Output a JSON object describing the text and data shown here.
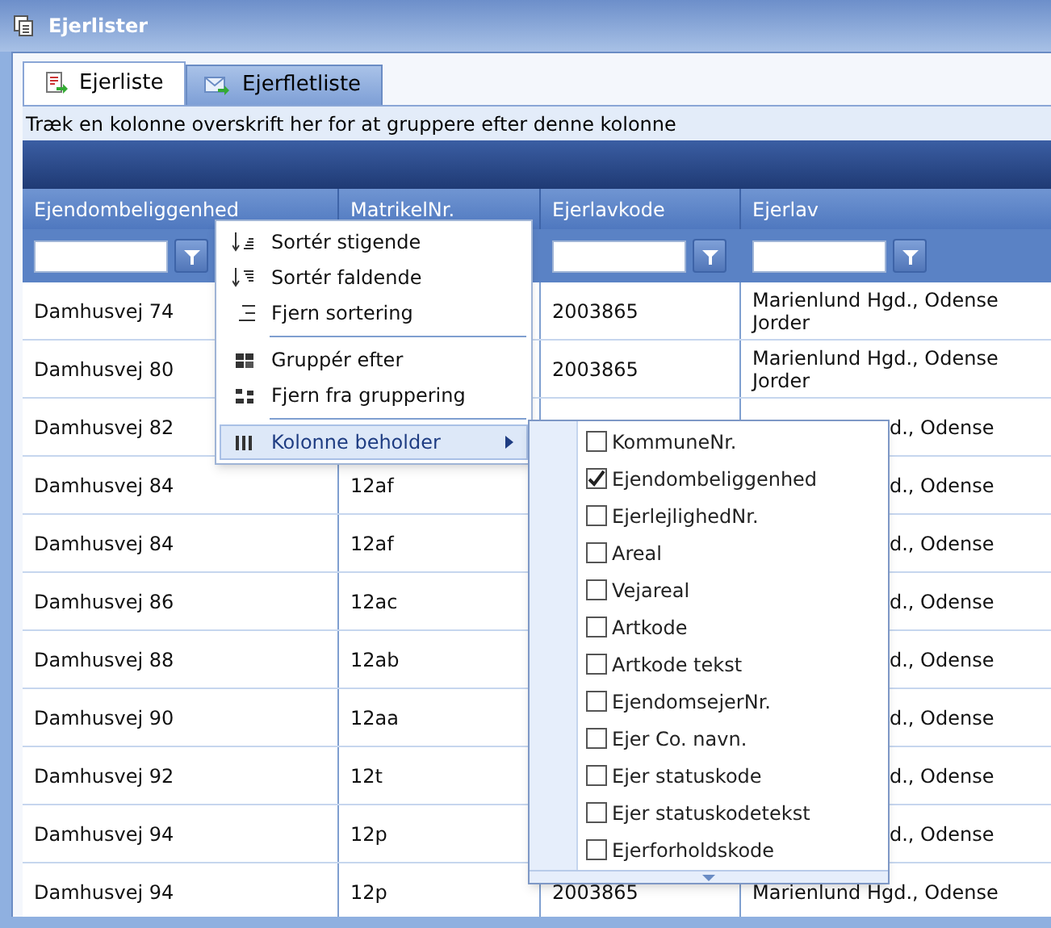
{
  "window": {
    "title": "Ejerlister"
  },
  "tabs": [
    {
      "label": "Ejerliste",
      "selected": true
    },
    {
      "label": "Ejerfletliste",
      "selected": false
    }
  ],
  "group_hint": "Træk en kolonne overskrift her for at gruppere efter denne kolonne",
  "table": {
    "columns": [
      {
        "label": "Ejendombeliggenhed",
        "has_filter": true
      },
      {
        "label": "MatrikelNr.",
        "has_filter": false
      },
      {
        "label": "Ejerlavkode",
        "has_filter": true
      },
      {
        "label": "Ejerlav",
        "has_filter": true
      }
    ],
    "rows": [
      {
        "cells": [
          "Damhusvej 74",
          null,
          "2003865",
          "Marienlund Hgd., Odense Jorder"
        ]
      },
      {
        "cells": [
          "Damhusvej 80",
          null,
          "2003865",
          "Marienlund Hgd., Odense Jorder"
        ]
      },
      {
        "cells": [
          "Damhusvej 82",
          null,
          null,
          "d., Odense"
        ]
      },
      {
        "cells": [
          "Damhusvej 84",
          "12af",
          null,
          "d., Odense"
        ]
      },
      {
        "cells": [
          "Damhusvej 84",
          "12af",
          null,
          "d., Odense"
        ]
      },
      {
        "cells": [
          "Damhusvej 86",
          "12ac",
          null,
          "d., Odense"
        ]
      },
      {
        "cells": [
          "Damhusvej 88",
          "12ab",
          null,
          "d., Odense"
        ]
      },
      {
        "cells": [
          "Damhusvej 90",
          "12aa",
          null,
          "d., Odense"
        ]
      },
      {
        "cells": [
          "Damhusvej 92",
          "12t",
          null,
          "d., Odense"
        ]
      },
      {
        "cells": [
          "Damhusvej 94",
          "12p",
          null,
          "d., Odense"
        ]
      },
      {
        "cells": [
          "Damhusvej 94",
          "12p",
          "2003865",
          "Marienlund Hgd., Odense"
        ]
      }
    ]
  },
  "context_menu": {
    "items": [
      {
        "kind": "item",
        "label": "Sortér stigende",
        "selected": false,
        "submenu": false
      },
      {
        "kind": "item",
        "label": "Sortér faldende",
        "selected": false,
        "submenu": false
      },
      {
        "kind": "item",
        "label": "Fjern sortering",
        "selected": false,
        "submenu": false
      },
      {
        "kind": "separator"
      },
      {
        "kind": "item",
        "label": "Gruppér efter",
        "selected": false,
        "submenu": false
      },
      {
        "kind": "item",
        "label": "Fjern fra gruppering",
        "selected": false,
        "submenu": false
      },
      {
        "kind": "separator"
      },
      {
        "kind": "item",
        "label": "Kolonne beholder",
        "selected": true,
        "submenu": true
      }
    ]
  },
  "column_chooser": {
    "items": [
      {
        "label": "KommuneNr.",
        "checked": false
      },
      {
        "label": "Ejendombeliggenhed",
        "checked": true
      },
      {
        "label": "EjerlejlighedNr.",
        "checked": false
      },
      {
        "label": "Areal",
        "checked": false
      },
      {
        "label": "Vejareal",
        "checked": false
      },
      {
        "label": "Artkode",
        "checked": false
      },
      {
        "label": "Artkode tekst",
        "checked": false
      },
      {
        "label": "EjendomsejerNr.",
        "checked": false
      },
      {
        "label": "Ejer Co. navn.",
        "checked": false
      },
      {
        "label": "Ejer statuskode",
        "checked": false
      },
      {
        "label": "Ejer statuskodetekst",
        "checked": false
      },
      {
        "label": "Ejerforholdskode",
        "checked": false
      }
    ]
  }
}
